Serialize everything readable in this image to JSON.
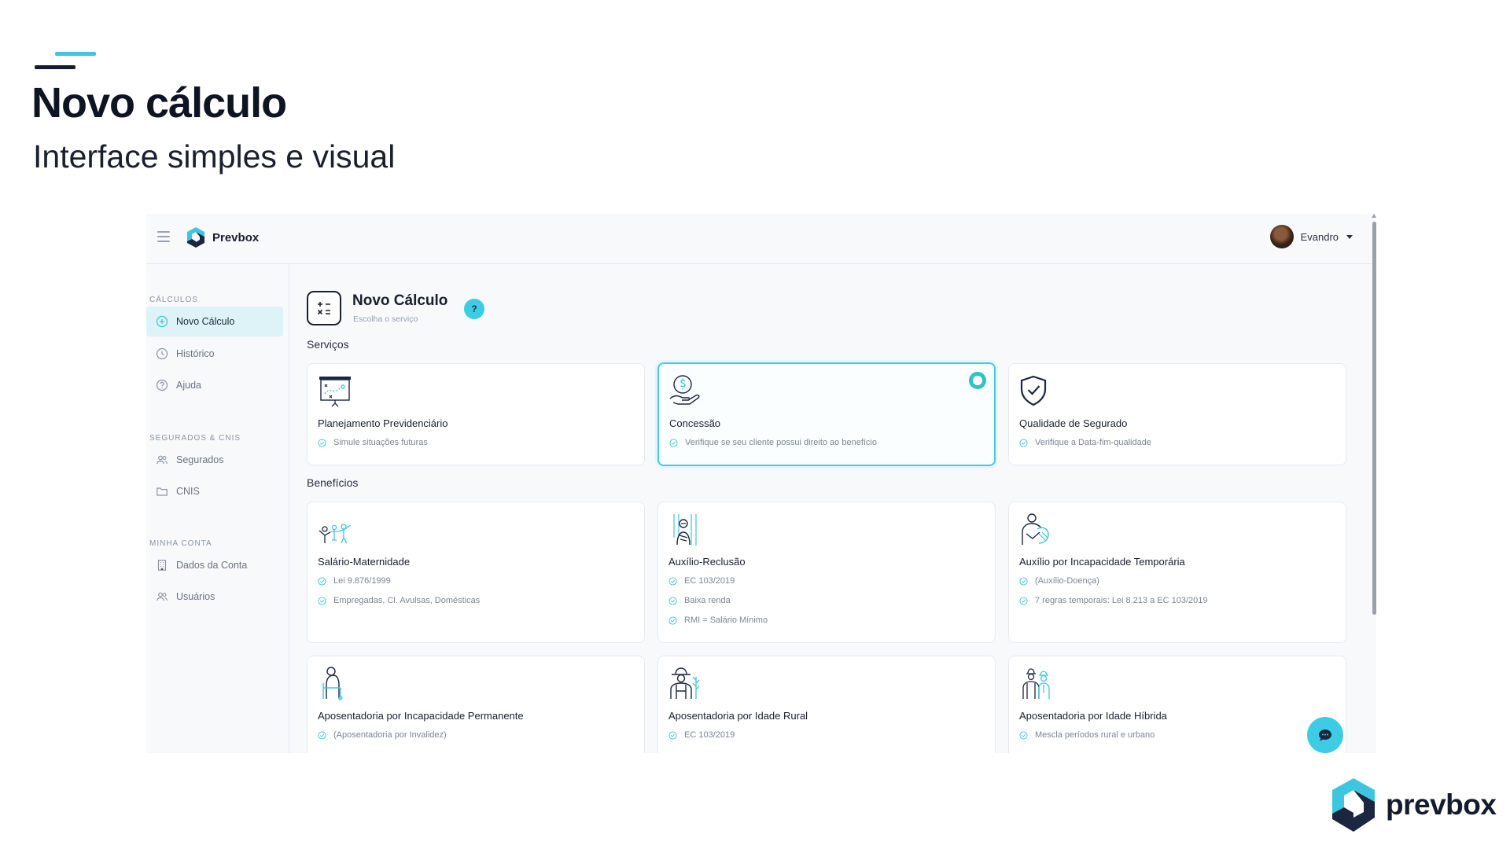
{
  "slide": {
    "title": "Novo cálculo",
    "subtitle": "Interface simples e visual",
    "logo_text": "prevbox"
  },
  "app": {
    "brand": "Prevbox",
    "user_name": "Evandro",
    "menu_icon": "hamburger-icon"
  },
  "sidebar": {
    "sections": [
      {
        "label": "CÁLCULOS",
        "items": [
          {
            "label": "Novo Cálculo",
            "icon": "plus-circle-icon",
            "active": true
          },
          {
            "label": "Histórico",
            "icon": "clock-icon"
          },
          {
            "label": "Ajuda",
            "icon": "help-circle-icon"
          }
        ]
      },
      {
        "label": "SEGURADOS & CNIS",
        "items": [
          {
            "label": "Segurados",
            "icon": "users-icon"
          },
          {
            "label": "CNIS",
            "icon": "folder-icon"
          }
        ]
      },
      {
        "label": "MINHA CONTA",
        "items": [
          {
            "label": "Dados da Conta",
            "icon": "building-icon"
          },
          {
            "label": "Usuários",
            "icon": "users-icon"
          }
        ]
      }
    ]
  },
  "main": {
    "title": "Novo Cálculo",
    "subtitle": "Escolha o serviço",
    "help_label": "?",
    "services_label": "Serviços",
    "benefits_label": "Benefícios",
    "services": [
      {
        "title": "Planejamento Previdenciário",
        "icon": "presentation-board-icon",
        "lines": [
          "Simule situações futuras"
        ]
      },
      {
        "title": "Concessão",
        "icon": "money-hand-icon",
        "lines": [
          "Verifique se seu cliente possui direito ao benefício"
        ],
        "selected": true
      },
      {
        "title": "Qualidade de Segurado",
        "icon": "shield-check-icon",
        "lines": [
          "Verifique a Data-fim-qualidade"
        ]
      }
    ],
    "benefits": [
      {
        "title": "Salário-Maternidade",
        "icon": "family-icon",
        "lines": [
          "Lei 9.876/1999",
          "Empregadas, Cl. Avulsas, Domésticas"
        ]
      },
      {
        "title": "Auxílio-Reclusão",
        "icon": "prisoner-icon",
        "lines": [
          "EC 103/2019",
          "Baixa renda",
          "RMI = Salário Mínimo"
        ]
      },
      {
        "title": "Auxílio por Incapacidade Temporária",
        "icon": "injured-person-icon",
        "lines": [
          "(Auxílio-Doença)",
          "7 regras temporais: Lei 8.213 a EC 103/2019"
        ]
      },
      {
        "title": "Aposentadoria por Incapacidade Permanente",
        "icon": "elderly-walker-icon",
        "lines": [
          "(Aposentadoria por Invalidez)"
        ]
      },
      {
        "title": "Aposentadoria por Idade Rural",
        "icon": "farmer-icon",
        "lines": [
          "EC 103/2019"
        ]
      },
      {
        "title": "Aposentadoria por Idade Híbrida",
        "icon": "workers-icon",
        "lines": [
          "Mescla períodos rural e urbano"
        ]
      }
    ],
    "chat_icon": "chat-bubble-icon"
  },
  "colors": {
    "accent": "#3ecbe4",
    "selected_border": "#45cbe0",
    "dark": "#141b2d"
  }
}
